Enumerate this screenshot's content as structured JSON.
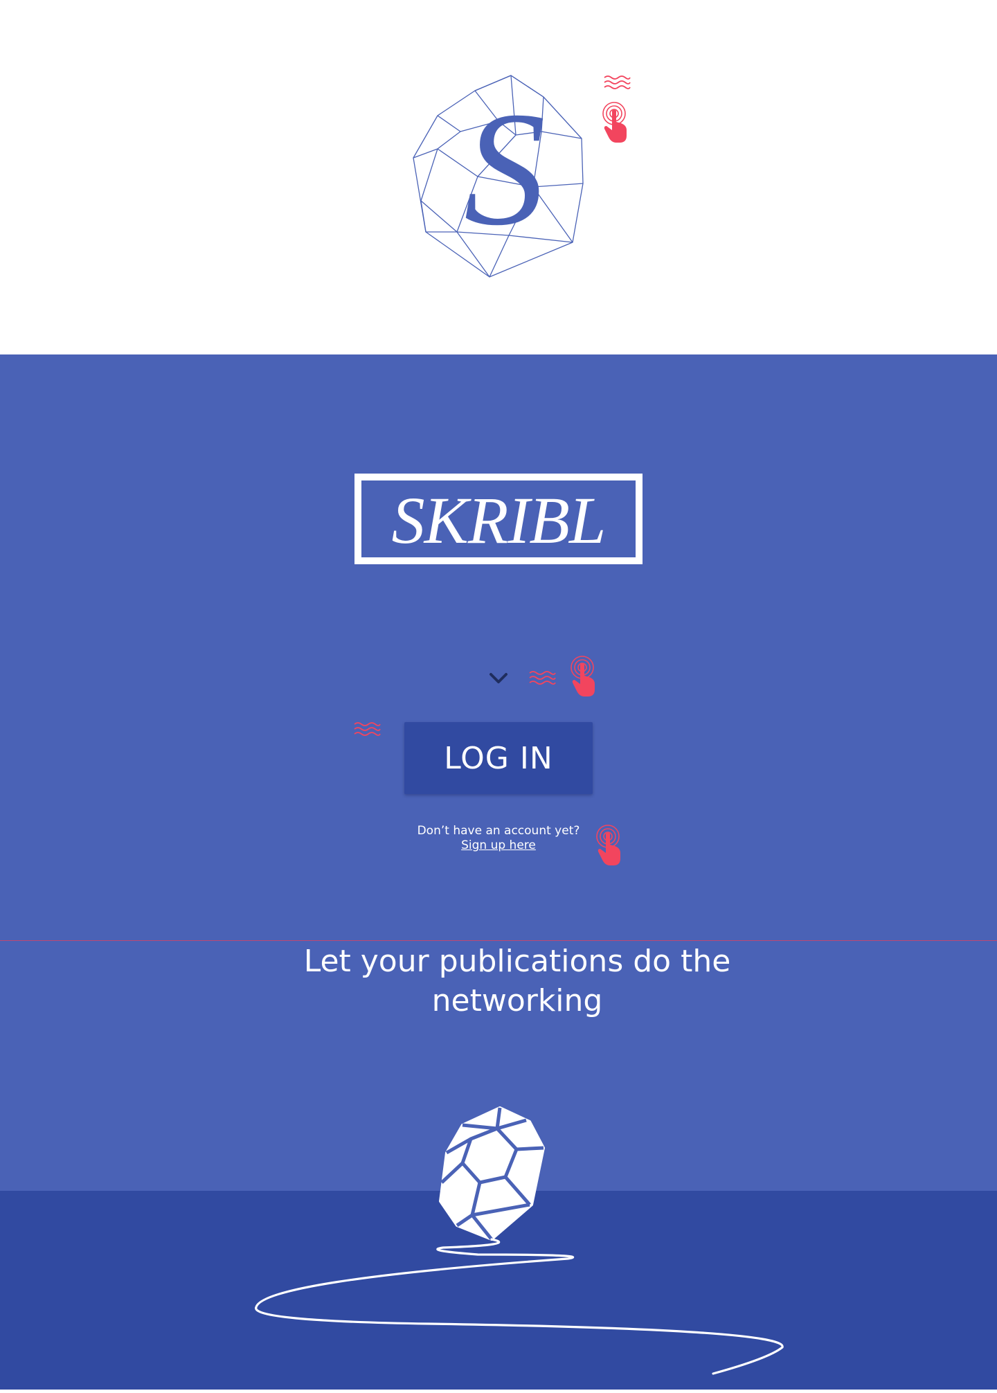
{
  "brand": {
    "monogram": "S",
    "wordmark": "SKRIBL"
  },
  "login": {
    "button_label": "LOG IN"
  },
  "signup": {
    "prompt": "Don’t have an account yet?",
    "link_label": "Sign up here"
  },
  "hero": {
    "tagline": "Let your publications do the networking"
  },
  "icons": {
    "tap": "tap-gesture-icon",
    "wave": "vibration-wave-icon",
    "chevron": "chevron-down-icon",
    "gem": "gem-icon"
  },
  "colors": {
    "primary": "#4a62b6",
    "primary_dark": "#314aa1",
    "accent": "#f2455e",
    "text_on_primary": "#ffffff",
    "chevron": "#1f2d5e"
  }
}
